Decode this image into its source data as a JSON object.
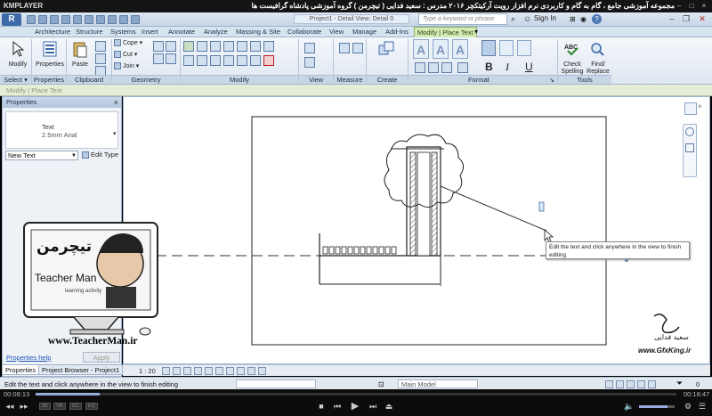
{
  "player": {
    "logo": "KMPLAYER",
    "title": "مجموعه آموزشی جامع ، گام به گام و کاربردی نرم افزار رویت آرکیتکچر ۲۰۱۶ مدرس : سعید فدایی ( تیچرمن ) گروه آموزشی پادشاه گرافیست ها",
    "time_current": "00:08:13",
    "time_total": "00:18:47",
    "progress_fraction": 0.1
  },
  "revit": {
    "app_button": "R",
    "doc_title": "Project1 - Detail View: Detail 0",
    "search_placeholder": "Type a keyword or phrase",
    "sign_in": "Sign In",
    "help": "?",
    "tabs": [
      "Architecture",
      "Structure",
      "Systems",
      "Insert",
      "Annotate",
      "Analyze",
      "Massing & Site",
      "Collaborate",
      "View",
      "Manage",
      "Add-Ins",
      "Modify | Place Text"
    ],
    "ribbon": {
      "modify": "Modify",
      "properties": "Properties",
      "paste": "Paste",
      "cope": "Cope",
      "cut": "Cut",
      "join": "Join",
      "check_spelling": "Check Spelling",
      "find_replace": "Find/ Replace",
      "panels": {
        "select": "Select",
        "properties": "Properties",
        "clipboard": "Clipboard",
        "geometry": "Geometry",
        "modify": "Modify",
        "view": "View",
        "measure": "Measure",
        "create": "Create",
        "format": "Format",
        "tools": "Tools"
      }
    },
    "options_bar": "Modify | Place Text",
    "properties_palette": {
      "title": "Properties",
      "type_name": "Text",
      "type_sub": "2.5mm Arial",
      "instance_select": "New Text",
      "edit_type": "Edit Type",
      "help_link": "Properties help",
      "apply": "Apply"
    },
    "browser_tabs": [
      "Properties",
      "Project Browser - Project1"
    ],
    "view_bar": {
      "scale": "1 : 20"
    },
    "tooltip": "Edit the text and click anywhere in the view to finish editing",
    "status_text": "Edit the text and click anywhere in the view to finish editing",
    "workset": "Main Model",
    "selection_count": "0"
  },
  "overlay": {
    "teacher_name": "Teacher Man",
    "teacher_sub": "learning activity",
    "teacher_logo_fa": "تیچرمن",
    "site": "www.TeacherMan.ir",
    "author_fa": "سعید فدایی",
    "gfx_site": "www.GfxKing.ir"
  },
  "colors": {
    "accent": "#3c6aa8",
    "context_tab": "#d6e9b8"
  }
}
